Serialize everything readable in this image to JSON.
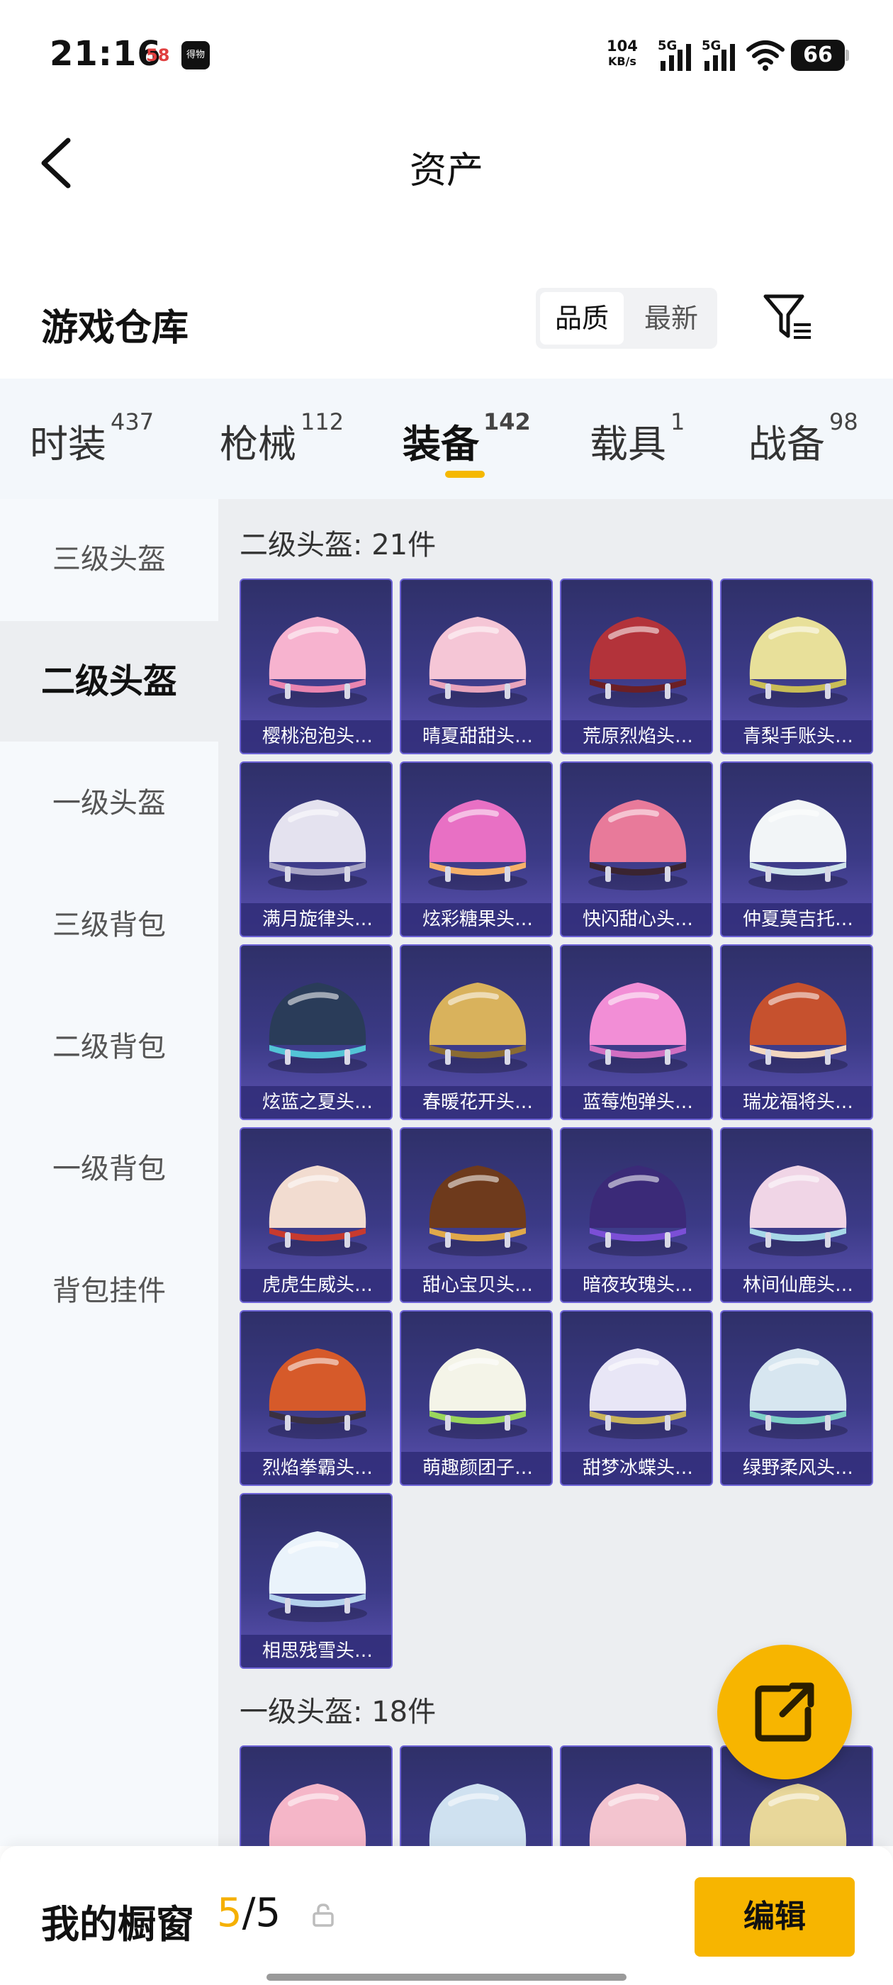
{
  "status_bar": {
    "time": "21:16",
    "app1": "58",
    "app2": "得物",
    "speed_value": "104",
    "speed_unit": "KB/s",
    "net1": "5G",
    "net2": "5G",
    "battery": "66"
  },
  "nav": {
    "title": "资产"
  },
  "header": {
    "heading": "游戏仓库",
    "sort_quality": "品质",
    "sort_latest": "最新"
  },
  "tabs": [
    {
      "label": "时装",
      "count": "437"
    },
    {
      "label": "枪械",
      "count": "112"
    },
    {
      "label": "装备",
      "count": "142"
    },
    {
      "label": "载具",
      "count": "1"
    },
    {
      "label": "战备",
      "count": "98"
    }
  ],
  "sidebar": [
    {
      "label": "三级头盔"
    },
    {
      "label": "二级头盔"
    },
    {
      "label": "一级头盔"
    },
    {
      "label": "三级背包"
    },
    {
      "label": "二级背包"
    },
    {
      "label": "一级背包"
    },
    {
      "label": "背包挂件"
    }
  ],
  "sections": [
    {
      "title": "二级头盔: 21件",
      "items": [
        {
          "name": "樱桃泡泡头…",
          "colors": [
            "#f7b3cf",
            "#e985b0"
          ]
        },
        {
          "name": "晴夏甜甜头…",
          "colors": [
            "#f5c6d6",
            "#e8a4bc"
          ]
        },
        {
          "name": "荒原烈焰头…",
          "colors": [
            "#b3333a",
            "#6c1f25"
          ]
        },
        {
          "name": "青梨手账头…",
          "colors": [
            "#e8e09a",
            "#c9bd57"
          ]
        },
        {
          "name": "满月旋律头…",
          "colors": [
            "#e4e2ef",
            "#a9a6c6"
          ]
        },
        {
          "name": "炫彩糖果头…",
          "colors": [
            "#e870c4",
            "#f5b06a"
          ]
        },
        {
          "name": "快闪甜心头…",
          "colors": [
            "#e87a9a",
            "#3a2430"
          ]
        },
        {
          "name": "仲夏莫吉托…",
          "colors": [
            "#f2f5f7",
            "#cfe3ea"
          ]
        },
        {
          "name": "炫蓝之夏头…",
          "colors": [
            "#2a3c59",
            "#53c4d6"
          ]
        },
        {
          "name": "春暖花开头…",
          "colors": [
            "#d9b25c",
            "#8a6b33"
          ]
        },
        {
          "name": "蓝莓炮弹头…",
          "colors": [
            "#f28ed6",
            "#d26fc2"
          ]
        },
        {
          "name": "瑞龙福将头…",
          "colors": [
            "#c6512e",
            "#f2d7c0"
          ]
        },
        {
          "name": "虎虎生威头…",
          "colors": [
            "#f2dcd0",
            "#c73a2e"
          ]
        },
        {
          "name": "甜心宝贝头…",
          "colors": [
            "#6e3a1c",
            "#e0a84a"
          ]
        },
        {
          "name": "暗夜玫瑰头…",
          "colors": [
            "#3b2a78",
            "#7b4fd6"
          ]
        },
        {
          "name": "林间仙鹿头…",
          "colors": [
            "#f0d5e6",
            "#a7d8e8"
          ]
        },
        {
          "name": "烈焰拳霸头…",
          "colors": [
            "#d65a2a",
            "#3a3040"
          ]
        },
        {
          "name": "萌趣颜团子…",
          "colors": [
            "#f4f4e8",
            "#9ad65c"
          ]
        },
        {
          "name": "甜梦冰蝶头…",
          "colors": [
            "#e8e6f6",
            "#c9b45a"
          ]
        },
        {
          "name": "绿野柔风头…",
          "colors": [
            "#d7e6f0",
            "#7ed0c6"
          ]
        },
        {
          "name": "相思残雪头…",
          "colors": [
            "#eaf3fb",
            "#b5d2ec"
          ]
        }
      ]
    },
    {
      "title": "一级头盔: 18件",
      "items": [
        {
          "name": "",
          "colors": [
            "#f5b6c8",
            "#eaa0b8"
          ]
        },
        {
          "name": "",
          "colors": [
            "#cfe1f0",
            "#9cc5e0"
          ]
        },
        {
          "name": "",
          "colors": [
            "#f3c4cf",
            "#e3a1b2"
          ]
        },
        {
          "name": "",
          "colors": [
            "#e8d79a",
            "#c9b35c"
          ]
        }
      ]
    }
  ],
  "bottom": {
    "showcase_label": "我的橱窗",
    "count_current": "5",
    "count_total": "/5",
    "edit_label": "编辑"
  }
}
